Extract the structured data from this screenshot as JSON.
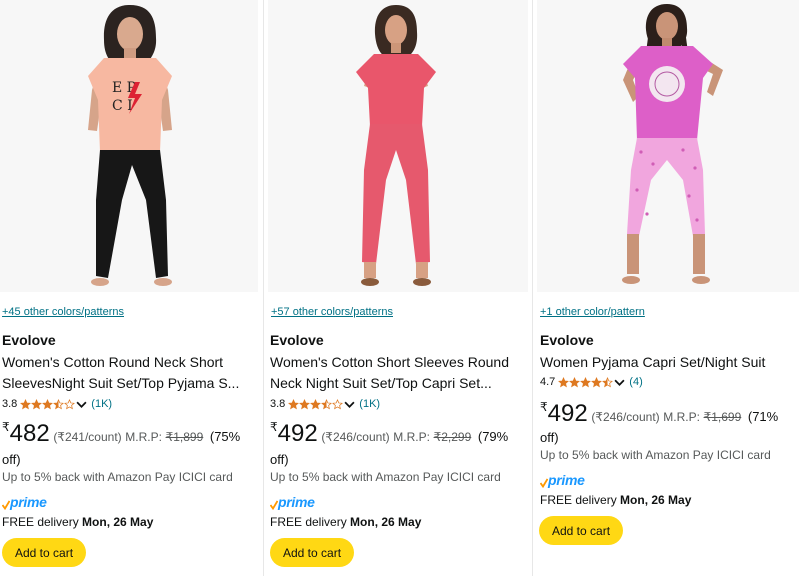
{
  "products": [
    {
      "colors": "+45 other colors/patterns",
      "brand": "Evolove",
      "title_line1": "Women's Cotton Round Neck Short",
      "title_line2": "SleevesNight Suit Set/Top Pyjama S...",
      "rating": "3.8",
      "review_count": "(1K)",
      "rupee": "₹",
      "price": "482",
      "unit_price": "(₹241/count)",
      "mrp_label": "M.R.P:",
      "mrp": "₹1,899",
      "discount_a": "(75%",
      "discount_b": "off)",
      "cashback": "Up to 5% back with Amazon Pay ICICI card",
      "prime": "prime",
      "delivery_label": "FREE delivery",
      "delivery_date": "Mon, 26 May",
      "cart_label": "Add to cart",
      "stars": [
        1,
        1,
        1,
        0.5,
        0
      ]
    },
    {
      "colors": "+57 other colors/patterns",
      "brand": "Evolove",
      "title_line1": "Women's Cotton Short Sleeves Round",
      "title_line2": "Neck Night Suit Set/Top Capri Set...",
      "rating": "3.8",
      "review_count": "(1K)",
      "rupee": "₹",
      "price": "492",
      "unit_price": "(₹246/count)",
      "mrp_label": "M.R.P:",
      "mrp": "₹2,299",
      "discount_a": "(79%",
      "discount_b": "off)",
      "cashback": "Up to 5% back with Amazon Pay ICICI card",
      "prime": "prime",
      "delivery_label": "FREE delivery",
      "delivery_date": "Mon, 26 May",
      "cart_label": "Add to cart",
      "stars": [
        1,
        1,
        1,
        0.5,
        0
      ]
    },
    {
      "colors": "+1 other color/pattern",
      "brand": "Evolove",
      "title_line1": "Women Pyjama Capri Set/Night Suit",
      "rating": "4.7",
      "review_count": "(4)",
      "rupee": "₹",
      "price": "492",
      "unit_price": "(₹246/count)",
      "mrp_label": "M.R.P:",
      "mrp": "₹1,699",
      "discount_a": "(71%",
      "discount_b": "off)",
      "cashback": "Up to 5% back with Amazon Pay ICICI card",
      "prime": "prime",
      "delivery_label": "FREE delivery",
      "delivery_date": "Mon, 26 May",
      "cart_label": "Add to cart",
      "stars": [
        1,
        1,
        1,
        1,
        0.5
      ]
    }
  ],
  "colors": {
    "link": "#007185",
    "star": "#de7921",
    "cart_button": "#ffd814",
    "prime": "#1a98ff",
    "image_bg": "#f7f7f7"
  }
}
